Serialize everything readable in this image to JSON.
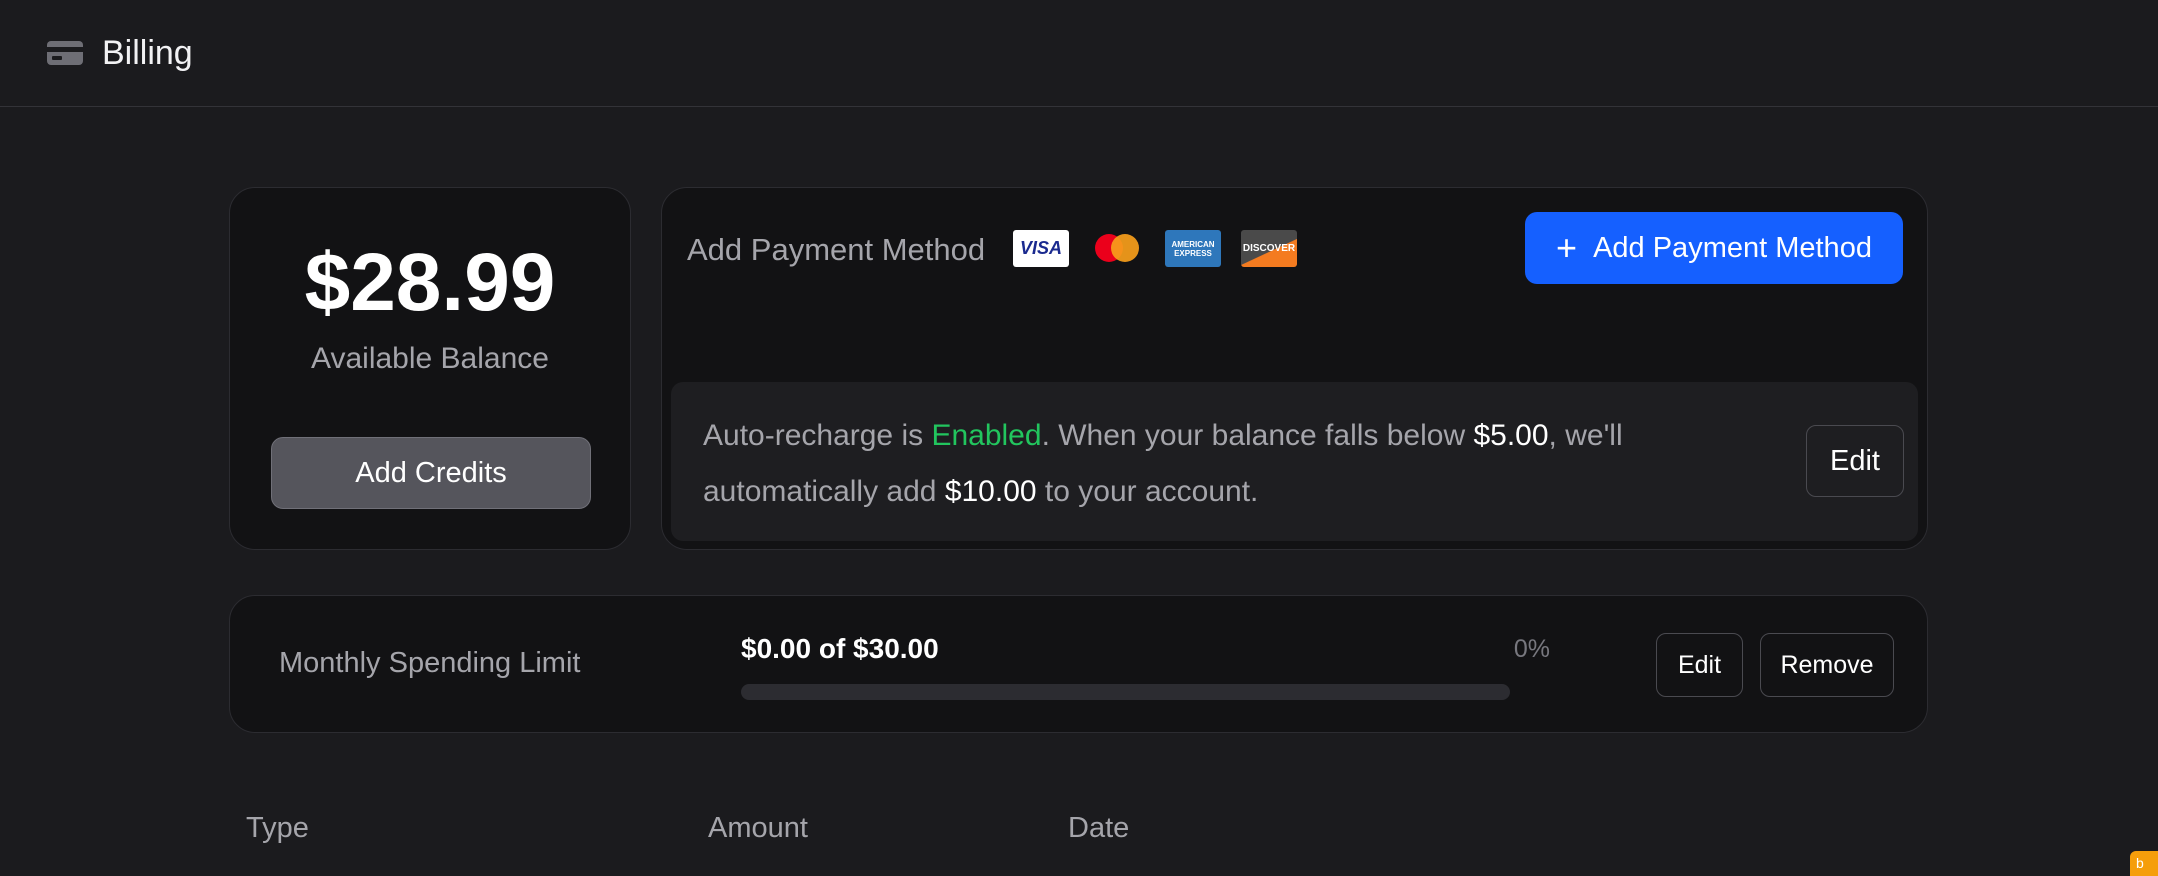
{
  "header": {
    "icon": "credit-card-icon",
    "title": "Billing"
  },
  "balance": {
    "amount": "$28.99",
    "label": "Available Balance",
    "add_credits_label": "Add Credits"
  },
  "payment": {
    "label": "Add Payment Method",
    "card_logos": [
      {
        "name": "visa",
        "text": "VISA"
      },
      {
        "name": "mastercard",
        "text": ""
      },
      {
        "name": "amex",
        "text": "AMERICAN EXPRESS"
      },
      {
        "name": "discover",
        "text": "DISCOVER"
      }
    ],
    "add_button_label": "Add Payment Method",
    "add_button_color": "#1560ff"
  },
  "auto_recharge": {
    "prefix": "Auto-recharge is ",
    "status": "Enabled",
    "status_color": "#22c55e",
    "mid1": ". When your balance falls below ",
    "threshold": "$5.00",
    "mid2": ", we'll automatically add ",
    "amount": "$10.00",
    "suffix": " to your account.",
    "edit_label": "Edit"
  },
  "spending_limit": {
    "label": "Monthly Spending Limit",
    "value_text": "$0.00 of $30.00",
    "percent_text": "0%",
    "progress_fraction": 0,
    "edit_label": "Edit",
    "remove_label": "Remove"
  },
  "table": {
    "columns": [
      "Type",
      "Amount",
      "Date"
    ]
  },
  "corner_badge": {
    "text": "b"
  }
}
